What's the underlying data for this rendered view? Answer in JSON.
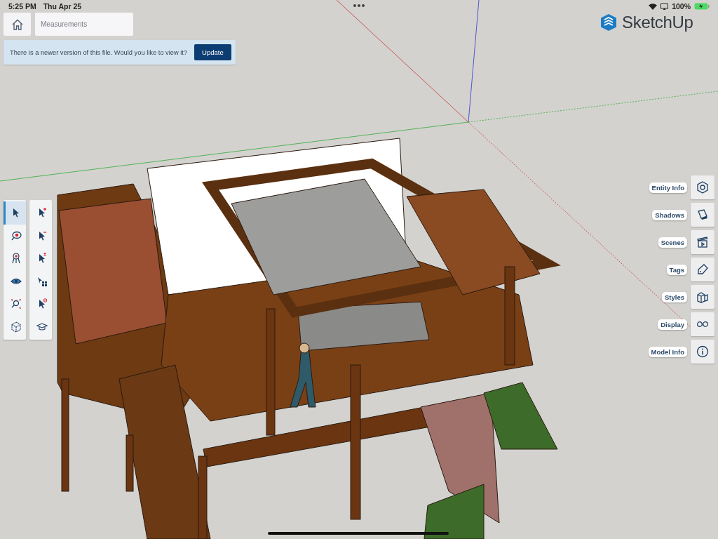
{
  "status_bar": {
    "time": "5:25 PM",
    "date": "Thu Apr 25",
    "battery": "100%"
  },
  "measurements": {
    "placeholder": "Measurements"
  },
  "banner": {
    "message": "There is a newer version of this file. Would you like to view it?",
    "button": "Update"
  },
  "logo": {
    "text": "SketchUp"
  },
  "tools": [
    {
      "kind": "select",
      "selected": true
    },
    {
      "kind": "tape",
      "selected": false
    },
    {
      "kind": "tripod",
      "selected": false
    },
    {
      "kind": "eye",
      "selected": false
    },
    {
      "kind": "zoom",
      "selected": false
    },
    {
      "kind": "cube",
      "selected": false
    }
  ],
  "selection_tools": [
    {
      "kind": "plus",
      "selected": false
    },
    {
      "kind": "minus",
      "selected": false
    },
    {
      "kind": "toggle",
      "selected": false
    },
    {
      "kind": "grid",
      "selected": false
    },
    {
      "kind": "none",
      "selected": false
    },
    {
      "kind": "cap",
      "selected": false
    }
  ],
  "panels": [
    {
      "label": "Entity Info",
      "kind": "entity"
    },
    {
      "label": "Shadows",
      "kind": "shadows"
    },
    {
      "label": "Scenes",
      "kind": "scenes"
    },
    {
      "label": "Tags",
      "kind": "tags"
    },
    {
      "label": "Styles",
      "kind": "styles"
    },
    {
      "label": "Display",
      "kind": "display"
    },
    {
      "label": "Model Info",
      "kind": "info"
    }
  ]
}
